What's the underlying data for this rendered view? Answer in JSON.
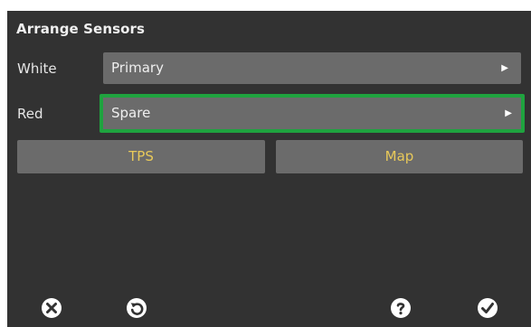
{
  "dialog": {
    "title": "Arrange Sensors"
  },
  "rows": [
    {
      "label": "White",
      "value": "Primary"
    },
    {
      "label": "Red",
      "value": "Spare"
    }
  ],
  "buttons": {
    "tps": "TPS",
    "map": "Map"
  },
  "toolbar": {
    "icons": [
      "close-icon",
      "undo-icon",
      "help-icon",
      "confirm-icon"
    ]
  },
  "colors": {
    "panel": "#323232",
    "control": "#6b6b6b",
    "selection_border": "#1fa33f",
    "button_text": "#e8c95a"
  }
}
